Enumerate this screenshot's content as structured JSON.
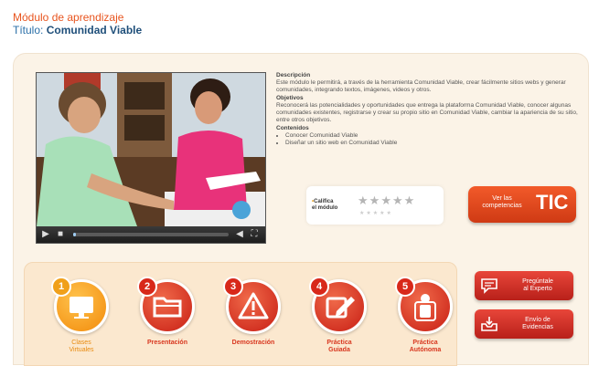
{
  "header": {
    "module_label": "Módulo de aprendizaje",
    "title_prefix": "Título:",
    "title_value": "Comunidad Viable"
  },
  "description": {
    "desc_heading": "Descripción",
    "desc_text": "Este módulo le permitirá, a través de la herramienta Comunidad Viable, crear fácilmente sitios webs y generar comunidades, integrando textos, imágenes, videos y otros.",
    "obj_heading": "Objetivos",
    "obj_text": "Reconocerá las potencialidades y oportunidades que entrega la plataforma Comunidad Viable, conocer algunas comunidades existentes, registrarse y crear su propio sitio en Comunidad Viable, cambiar la apariencia de su sitio, entre otros objetivos.",
    "contents_heading": "Contenidos",
    "contents": [
      "Conocer Comunidad Viable",
      "Diseñar un sitio web en Comunidad Viable"
    ]
  },
  "rating": {
    "label_line1": "Califica",
    "label_line2": "el módulo",
    "stars_value": 0,
    "stars_max": 5
  },
  "tic_button": {
    "small_line1": "Ver las",
    "small_line2": "competencias",
    "big": "TIC"
  },
  "steps": [
    {
      "number": "1",
      "label_line1": "Clases",
      "label_line2": "Virtuales",
      "icon": "monitor-icon"
    },
    {
      "number": "2",
      "label_line1": "Presentación",
      "label_line2": "",
      "icon": "folder-icon"
    },
    {
      "number": "3",
      "label_line1": "Demostración",
      "label_line2": "",
      "icon": "warning-icon"
    },
    {
      "number": "4",
      "label_line1": "Práctica",
      "label_line2": "Guiada",
      "icon": "pencil-icon"
    },
    {
      "number": "5",
      "label_line1": "Práctica",
      "label_line2": "Autónoma",
      "icon": "person-icon"
    }
  ],
  "side_buttons": [
    {
      "line1": "Pregúntale",
      "line2": "al Experto",
      "icon": "chat-icon"
    },
    {
      "line1": "Envío de",
      "line2": "Evidencias",
      "icon": "inbox-icon"
    }
  ],
  "video": {
    "progress": 0.02
  }
}
